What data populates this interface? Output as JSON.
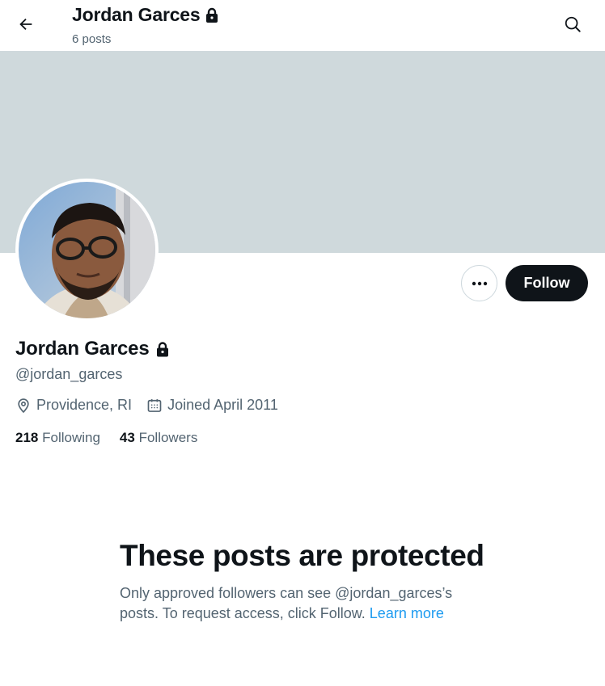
{
  "header": {
    "title": "Jordan Garces",
    "post_count": "6 posts",
    "back_icon": "arrow-left-icon",
    "search_icon": "search-icon"
  },
  "profile": {
    "name": "Jordan Garces",
    "handle": "@jordan_garces",
    "location": "Providence, RI",
    "joined": "Joined April 2011",
    "following_count": "218",
    "following_label": "Following",
    "followers_count": "43",
    "followers_label": "Followers",
    "lock_icon": "lock-icon"
  },
  "actions": {
    "follow_label": "Follow",
    "more_icon": "more-icon"
  },
  "protected": {
    "title": "These posts are protected",
    "body": "Only approved followers can see @jordan_garces’s posts. To request access, click Follow. ",
    "learn_more": "Learn more"
  },
  "colors": {
    "banner": "#cfd9dc",
    "text_primary": "#0f1419",
    "text_secondary": "#536471",
    "link": "#1d9bf0",
    "follow_bg": "#0f1419"
  }
}
